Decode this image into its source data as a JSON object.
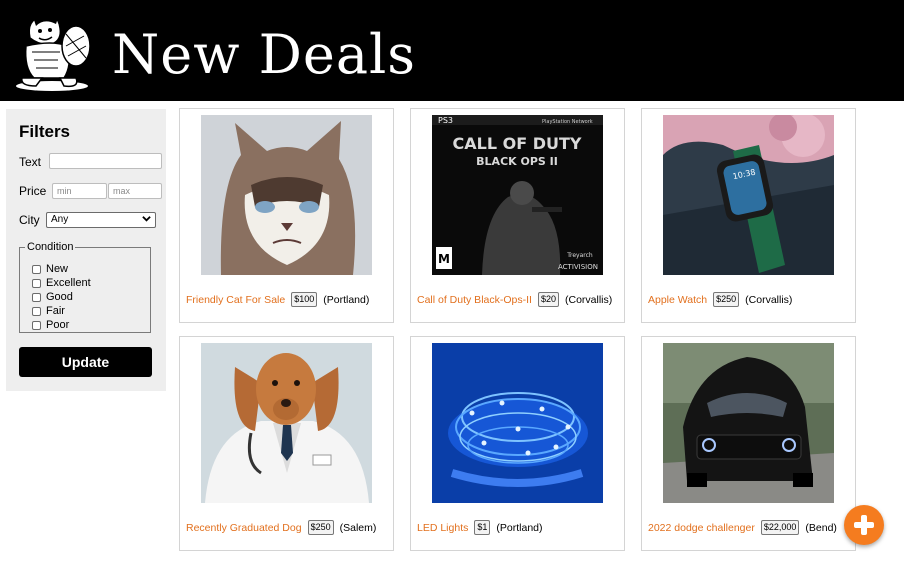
{
  "header": {
    "title": "New Deals",
    "logo_icon": "beaver-mascot-icon"
  },
  "filters": {
    "heading": "Filters",
    "text_label": "Text",
    "text_value": "",
    "price_label": "Price",
    "min_placeholder": "min",
    "max_placeholder": "max",
    "city_label": "City",
    "city_value": "Any",
    "condition_legend": "Condition",
    "conditions": [
      "New",
      "Excellent",
      "Good",
      "Fair",
      "Poor"
    ],
    "update_label": "Update"
  },
  "listings": [
    {
      "title": "Friendly Cat For Sale",
      "price": "$100",
      "city": "(Portland)"
    },
    {
      "title": "Call of Duty Black-Ops-II",
      "price": "$20",
      "city": "(Corvallis)"
    },
    {
      "title": "Apple Watch",
      "price": "$250",
      "city": "(Corvallis)"
    },
    {
      "title": "Recently Graduated Dog",
      "price": "$250",
      "city": "(Salem)"
    },
    {
      "title": "LED Lights",
      "price": "$1",
      "city": "(Portland)"
    },
    {
      "title": "2022 dodge challenger",
      "price": "$22,000",
      "city": "(Bend)"
    }
  ],
  "cover_art": {
    "ps3_mark": "PS3",
    "network_mark": "PlayStation Network",
    "game_title_top": "CALL OF DUTY",
    "game_title_bottom": "BLACK OPS II",
    "rating_mark": "M",
    "publisher_mark": "ACTIVISION",
    "developer_mark": "Treyarch"
  },
  "watch_face_time": "10:38",
  "add_button_icon": "plus-icon",
  "colors": {
    "accent": "#e2701e",
    "fab": "#f57c1f",
    "header_bg": "#000000",
    "panel_bg": "#eeeeee"
  }
}
